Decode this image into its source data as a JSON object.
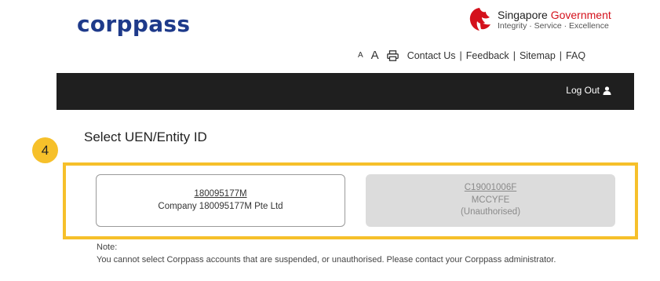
{
  "header": {
    "logo": "corppass",
    "gov_name_prefix": "Singapore",
    "gov_name_suffix": "Government",
    "gov_tagline": "Integrity · Service · Excellence"
  },
  "utility": {
    "font_small": "A",
    "font_large": "A",
    "links": [
      "Contact Us",
      "Feedback",
      "Sitemap",
      "FAQ"
    ],
    "separator": "|"
  },
  "navbar": {
    "logout_label": "Log Out"
  },
  "main": {
    "title": "Select UEN/Entity ID",
    "step_number": "4",
    "entities": [
      {
        "uen": "180095177M",
        "name": "Company 180095177M Pte Ltd",
        "status": ""
      },
      {
        "uen": "C19001006F",
        "name": "MCCYFE",
        "status": "(Unauthorised)"
      }
    ],
    "note_heading": "Note:",
    "note_text": "You cannot select Corppass accounts that are suspended, or unauthorised. Please contact your Corppass administrator."
  },
  "colors": {
    "brand_blue": "#1e3a8a",
    "gov_red": "#d4111c",
    "navbar": "#1f1f1f",
    "highlight": "#f6c02a",
    "disabled_card": "#dcdcdc"
  },
  "icons": [
    "lion-head-icon",
    "printer-icon",
    "user-icon"
  ]
}
